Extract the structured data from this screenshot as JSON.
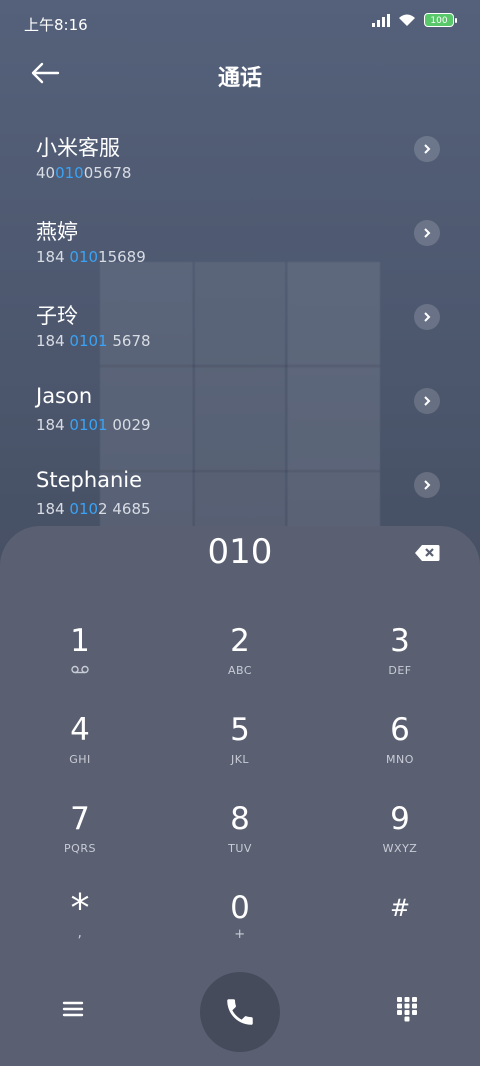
{
  "status_bar": {
    "time": "上午8:16",
    "battery": "100"
  },
  "header": {
    "title": "通话"
  },
  "contacts": [
    {
      "name": "小米客服",
      "number_pre": "40",
      "number_hl": "010",
      "number_post": "05678"
    },
    {
      "name": "燕婷",
      "number_pre": "184 ",
      "number_hl": "010",
      "number_post": "15689"
    },
    {
      "name": "子玲",
      "number_pre": "184 ",
      "number_hl": "0101",
      "number_post": " 5678"
    },
    {
      "name": "Jason",
      "number_pre": "184 ",
      "number_hl": "0101",
      "number_post": " 0029"
    },
    {
      "name": "Stephanie",
      "number_pre": "184 ",
      "number_hl": "010",
      "number_post": "2 4685"
    }
  ],
  "dialer": {
    "input_value": "010",
    "keys": [
      {
        "digit": "1",
        "letters": ""
      },
      {
        "digit": "2",
        "letters": "ABC"
      },
      {
        "digit": "3",
        "letters": "DEF"
      },
      {
        "digit": "4",
        "letters": "GHI"
      },
      {
        "digit": "5",
        "letters": "JKL"
      },
      {
        "digit": "6",
        "letters": "MNO"
      },
      {
        "digit": "7",
        "letters": "PQRS"
      },
      {
        "digit": "8",
        "letters": "TUV"
      },
      {
        "digit": "9",
        "letters": "WXYZ"
      },
      {
        "digit": "*",
        "letters": ","
      },
      {
        "digit": "0",
        "letters": "+"
      },
      {
        "digit": "#",
        "letters": ""
      }
    ]
  },
  "colors": {
    "highlight": "#3aa3f5",
    "panel": "#5a6072",
    "call_button": "#454b5b"
  }
}
